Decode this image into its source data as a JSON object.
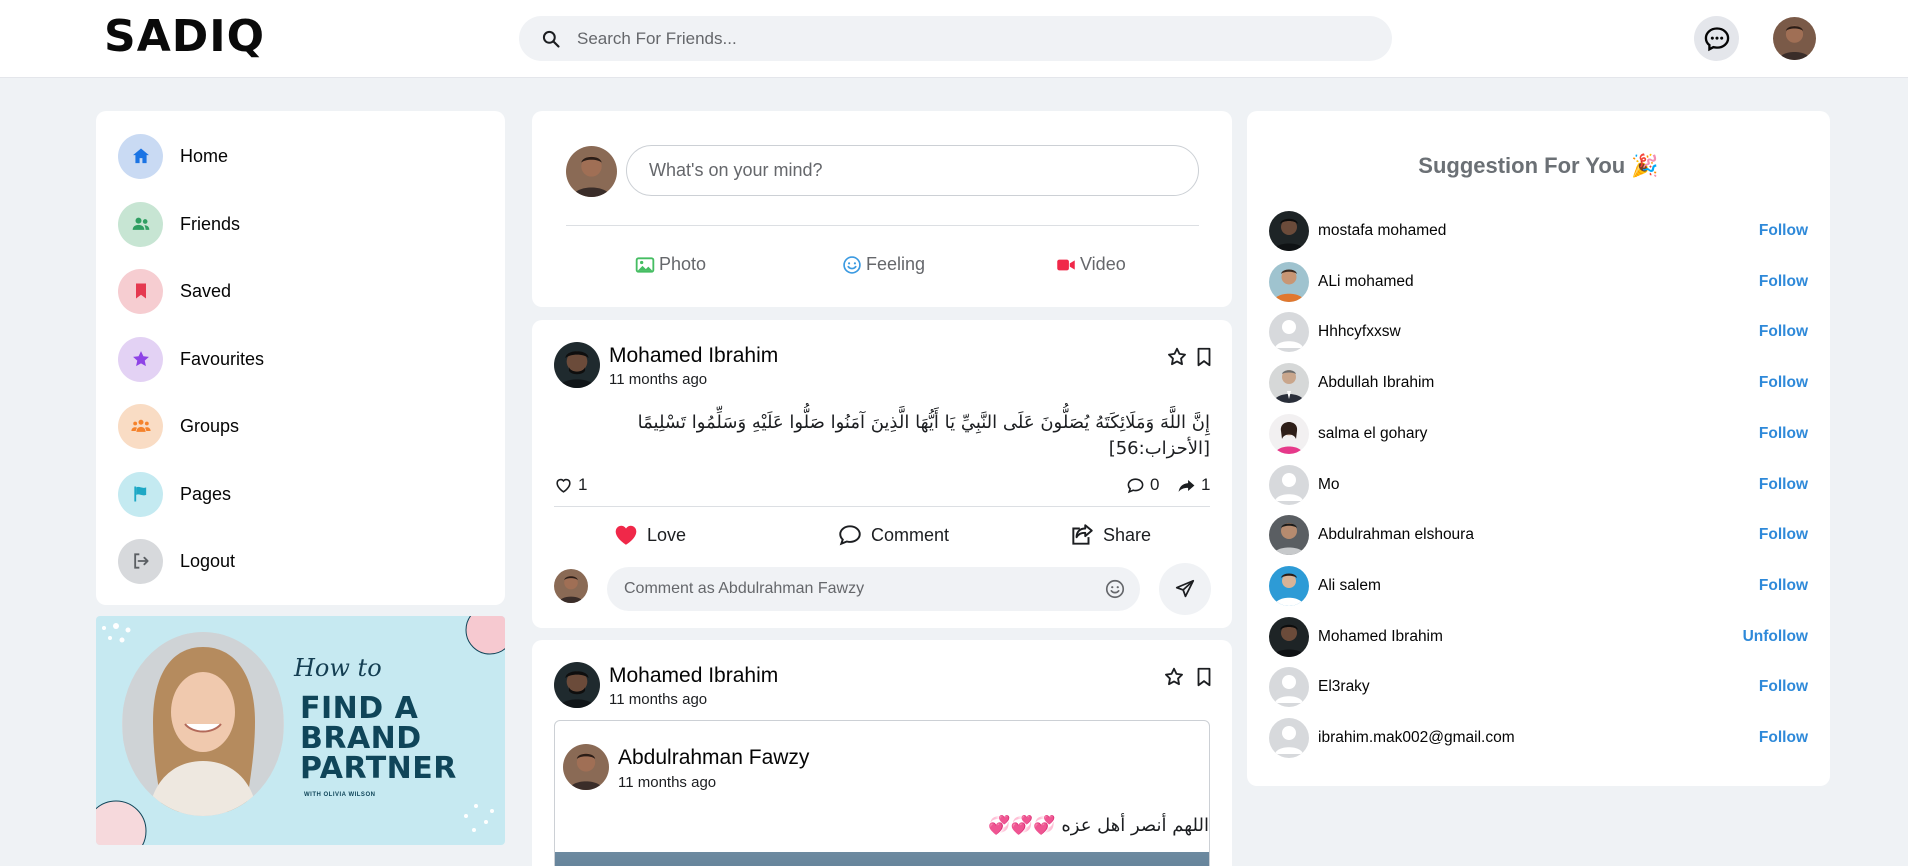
{
  "header": {
    "logo_text": "SADIQ",
    "search_placeholder": "Search For Friends...",
    "icons": [
      "search-icon",
      "messenger-icon",
      "avatar"
    ]
  },
  "sidebar": {
    "items": [
      {
        "label": "Home",
        "icon": "home-icon",
        "color": "#c9daf3",
        "fg": "#1b74e4"
      },
      {
        "label": "Friends",
        "icon": "friends-icon",
        "color": "#c7e5d3",
        "fg": "#2f9e62"
      },
      {
        "label": "Saved",
        "icon": "bookmark-icon",
        "color": "#f6cdd1",
        "fg": "#e53950"
      },
      {
        "label": "Favourites",
        "icon": "star-icon",
        "color": "#e3d2f4",
        "fg": "#8e43e6"
      },
      {
        "label": "Groups",
        "icon": "groups-icon",
        "color": "#f9dcc4",
        "fg": "#f5822b"
      },
      {
        "label": "Pages",
        "icon": "flag-icon",
        "color": "#c4eaf1",
        "fg": "#1ea8c5"
      },
      {
        "label": "Logout",
        "icon": "logout-icon",
        "color": "#d7d9dc",
        "fg": "#5b5f63"
      }
    ]
  },
  "promo": {
    "how_to": "How to",
    "title": "FIND A BRAND PARTNER",
    "subtitle": "WITH OLIVIA WILSON"
  },
  "composer": {
    "placeholder": "What's on your mind?",
    "actions": [
      {
        "label": "Photo",
        "icon": "photo-icon",
        "color": "#45bd62"
      },
      {
        "label": "Feeling",
        "icon": "feeling-icon",
        "color": "#3b9ae1"
      },
      {
        "label": "Video",
        "icon": "video-icon",
        "color": "#f02849"
      }
    ]
  },
  "posts": [
    {
      "author": "Mohamed Ibrahim",
      "time": "11 months ago",
      "text_line1": "إِنَّ اللَّهَ وَمَلَائِكَتَهُ يُصَلُّونَ عَلَى النَّبِيِّ يَا أَيُّهَا الَّذِينَ آمَنُوا صَلُّوا عَلَيْهِ وَسَلِّمُوا تَسْلِيمًا",
      "text_line2": "[الأحزاب:56]",
      "likes": "1",
      "comments": "0",
      "shares": "1",
      "actions": {
        "love": "Love",
        "comment": "Comment",
        "share": "Share"
      },
      "comment_placeholder": "Comment as Abdulrahman Fawzy"
    },
    {
      "author": "Mohamed Ibrahim",
      "time": "11 months ago",
      "shared": {
        "author": "Abdulrahman Fawzy",
        "time": "11 months ago",
        "text": "اللهم أنصر أهل عزه 💞💞💞"
      }
    }
  ],
  "suggestions": {
    "title": "Suggestion For You 🎉",
    "people": [
      {
        "name": "mostafa mohamed",
        "action": "Follow",
        "avatar": "dark"
      },
      {
        "name": "ALi mohamed",
        "action": "Follow",
        "avatar": "orange"
      },
      {
        "name": "Hhhcyfxxsw",
        "action": "Follow",
        "avatar": "default"
      },
      {
        "name": "Abdullah Ibrahim",
        "action": "Follow",
        "avatar": "suit"
      },
      {
        "name": "salma el gohary",
        "action": "Follow",
        "avatar": "pink"
      },
      {
        "name": "Mo",
        "action": "Follow",
        "avatar": "default"
      },
      {
        "name": "Abdulrahman elshoura",
        "action": "Follow",
        "avatar": "gray"
      },
      {
        "name": "Ali salem",
        "action": "Follow",
        "avatar": "blue"
      },
      {
        "name": "Mohamed Ibrahim",
        "action": "Unfollow",
        "avatar": "dark"
      },
      {
        "name": "El3raky",
        "action": "Follow",
        "avatar": "default"
      },
      {
        "name": "ibrahim.mak002@gmail.com",
        "action": "Follow",
        "avatar": "default"
      }
    ]
  },
  "colors": {
    "accent_link": "#2e89d9",
    "love_red": "#f02849",
    "page_bg": "#eff2f5"
  }
}
